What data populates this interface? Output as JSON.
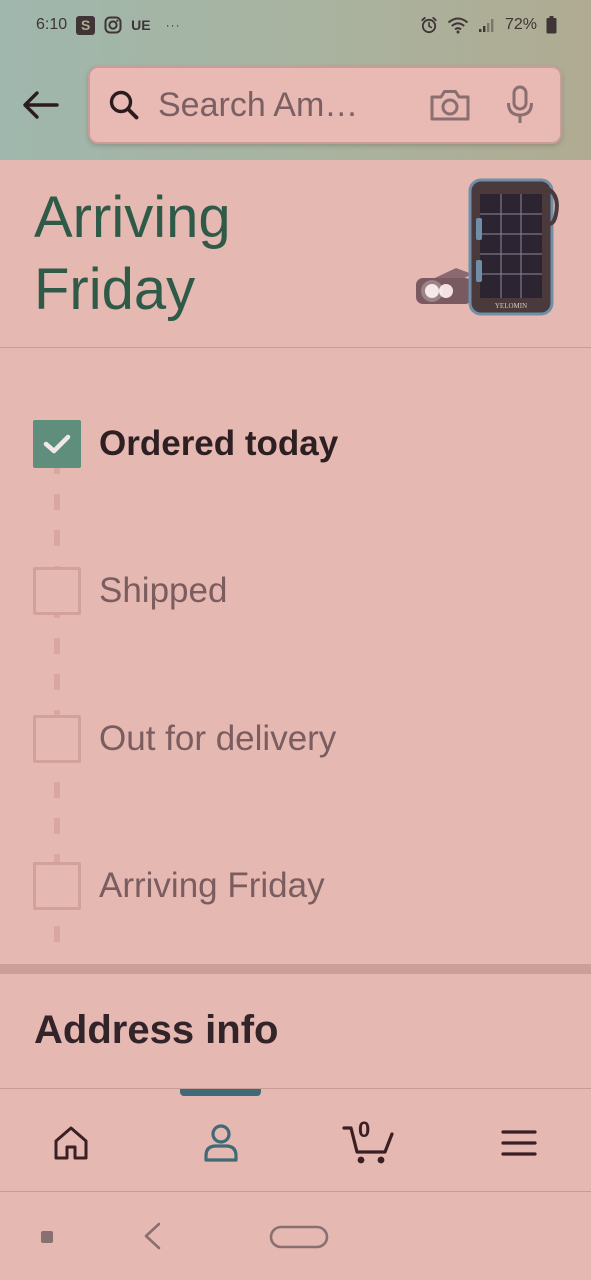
{
  "status_bar": {
    "time": "6:10",
    "app_s": "S",
    "app_ue": "UE",
    "dots": "···",
    "battery": "72%"
  },
  "search": {
    "placeholder": "Search Am…"
  },
  "arrival": {
    "title_line1": "Arriving",
    "title_line2": "Friday",
    "product_brand": "YELOMIN"
  },
  "timeline": {
    "steps": [
      {
        "label": "Ordered today",
        "done": true
      },
      {
        "label": "Shipped",
        "done": false
      },
      {
        "label": "Out for delivery",
        "done": false
      },
      {
        "label": "Arriving Friday",
        "done": false
      }
    ]
  },
  "address": {
    "title": "Address info"
  },
  "bottom_nav": {
    "cart_count": "0",
    "active": "account"
  },
  "colors": {
    "accent_green": "#2f5a47",
    "check_green": "#5f8f7c",
    "nav_active": "#3f6b76",
    "background": "#e5b8b2"
  }
}
